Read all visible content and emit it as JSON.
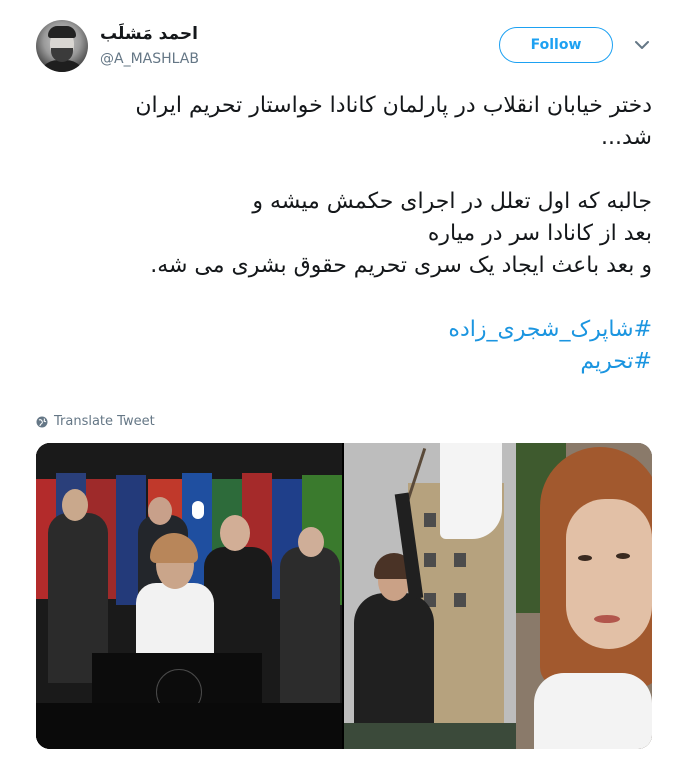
{
  "author": {
    "display_name": "احمد مَشلَب",
    "handle": "@A_MASHLAB"
  },
  "actions": {
    "follow_label": "Follow"
  },
  "tweet": {
    "line1": "دختر خیابان انقلاب در پارلمان کانادا خواستار تحریم ایران",
    "line2": "شد...",
    "line3": "جالبه که اول تعلل در اجرای حکمش میشه و",
    "line4": "بعد از کانادا سر در میاره",
    "line5": "و بعد باعث ایجاد یک سری تحریم حقوق بشری می شه.",
    "hashtag1": "#شاپرک_شجری_زاده",
    "hashtag2": "#تحریم"
  },
  "translate_label": "Translate Tweet",
  "colors": {
    "accent": "#1da1f2",
    "hashtag": "#1b95e0",
    "muted": "#657786"
  }
}
